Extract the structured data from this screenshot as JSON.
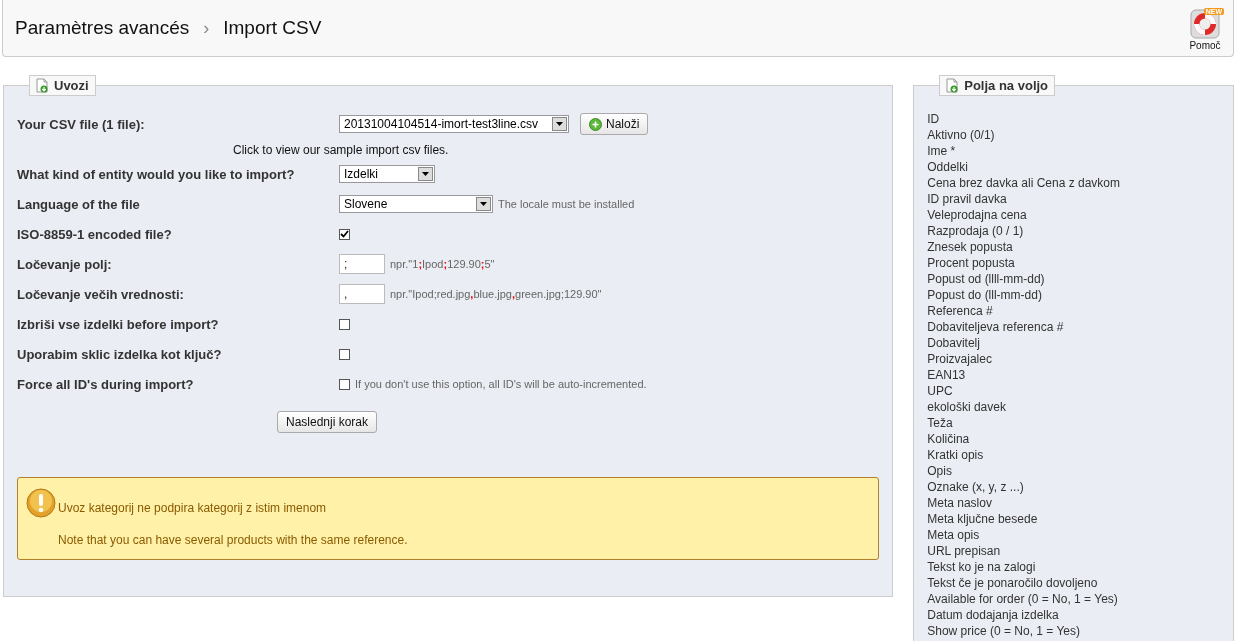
{
  "breadcrumb": {
    "parent": "Paramètres avancés",
    "separator": "›",
    "current": "Import CSV"
  },
  "help": {
    "badge": "NEW",
    "label": "Pomoč"
  },
  "import_panel": {
    "title": "Uvozi",
    "rows": [
      {
        "kind": "file",
        "label": "Your CSV file (1 file):",
        "value": "20131004104514-imort-test3line.csv",
        "button": "Naloži"
      },
      {
        "kind": "link",
        "text": "Click to view our sample import csv files."
      },
      {
        "kind": "select",
        "label": "What kind of entity would you like to import?",
        "value": "Izdelki"
      },
      {
        "kind": "select",
        "label": "Language of the file",
        "value": "Slovene",
        "note": "The locale must be installed"
      },
      {
        "kind": "checkbox",
        "label": "ISO-8859-1 encoded file?",
        "checked": true
      },
      {
        "kind": "text",
        "label": "Ločevanje polj:",
        "value": ";",
        "hint": [
          {
            "text": "npr.\"1",
            "red": false
          },
          {
            "text": ";",
            "red": true
          },
          {
            "text": "Ipod",
            "red": false
          },
          {
            "text": ";",
            "red": true
          },
          {
            "text": "129.90",
            "red": false
          },
          {
            "text": ";",
            "red": true
          },
          {
            "text": "5\"",
            "red": false
          }
        ]
      },
      {
        "kind": "text",
        "label": "Ločevanje večih vrednosti:",
        "value": ",",
        "hint": [
          {
            "text": "npr.\"Ipod;red.jpg",
            "red": false
          },
          {
            "text": ",",
            "red": true
          },
          {
            "text": "blue.jpg",
            "red": false
          },
          {
            "text": ",",
            "red": true
          },
          {
            "text": "green.jpg;129.90\"",
            "red": false
          }
        ]
      },
      {
        "kind": "checkbox",
        "label": "Izbriši vse izdelki before import?",
        "checked": false
      },
      {
        "kind": "checkbox",
        "label": "Uporabim sklic izdelka kot ključ?",
        "checked": false
      },
      {
        "kind": "checkbox",
        "label": "Force all ID's during import?",
        "checked": false,
        "note": "If you don't use this option, all ID's will be auto-incremented."
      }
    ],
    "submit": "Naslednji korak",
    "warnings": [
      "Uvoz kategorij ne podpira kategorij z istim imenom",
      "Note that you can have several products with the same reference."
    ]
  },
  "fields_panel": {
    "title": "Polja na voljo",
    "items": [
      "ID",
      "Aktivno (0/1)",
      "Ime *",
      "Oddelki",
      "Cena brez davka ali Cena z davkom",
      "ID pravil davka",
      "Veleprodajna cena",
      "Razprodaja (0 / 1)",
      "Znesek popusta",
      "Procent popusta",
      "Popust od (llll-mm-dd)",
      "Popust do (lll-mm-dd)",
      "Referenca #",
      "Dobaviteljeva referenca #",
      "Dobavitelj",
      "Proizvajalec",
      "EAN13",
      "UPC",
      "ekološki davek",
      "Teža",
      "Količina",
      "Kratki opis",
      "Opis",
      "Oznake (x, y, z ...)",
      "Meta naslov",
      "Meta ključne besede",
      "Meta opis",
      "URL prepisan",
      "Tekst ko je na zalogi",
      "Tekst če je ponaročilo dovoljeno",
      "Available for order (0 = No, 1 = Yes)",
      "Datum dodajanja izdelka",
      "Show price (0 = No, 1 = Yes)"
    ]
  }
}
